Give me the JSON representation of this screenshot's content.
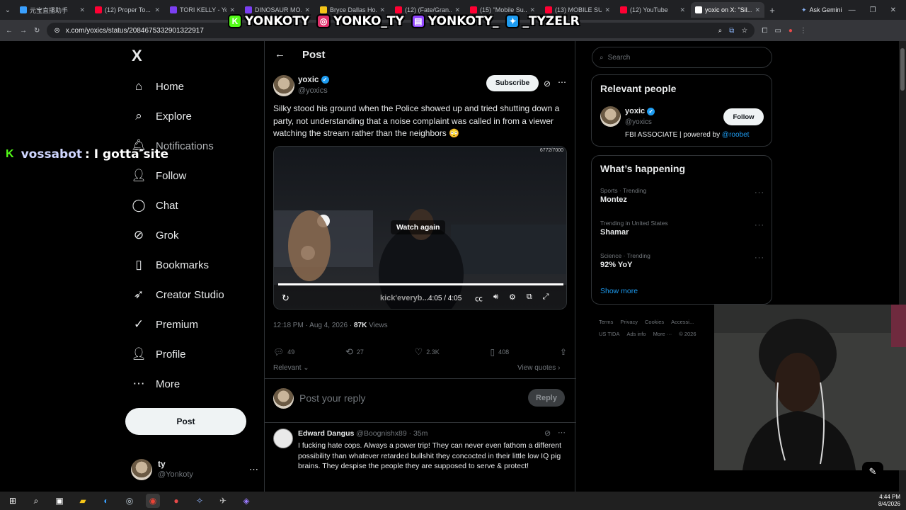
{
  "browser": {
    "tabs": [
      {
        "label": "元宝直播助手",
        "color": "#3aa0ff"
      },
      {
        "label": "(12) Proper To...",
        "color": "#ff0033"
      },
      {
        "label": "TORI KELLY - Yo...",
        "color": "#7b3ff2"
      },
      {
        "label": "DINOSAUR MO...",
        "color": "#7b3ff2"
      },
      {
        "label": "Bryce Dallas Ho...",
        "color": "#f5c518"
      },
      {
        "label": "(12) (Fate/Gran...",
        "color": "#ff0033"
      },
      {
        "label": "(15) \"Mobile Su...",
        "color": "#ff0033"
      },
      {
        "label": "(13) MOBILE SU...",
        "color": "#ff0033"
      },
      {
        "label": "(12) YouTube",
        "color": "#ff0033"
      },
      {
        "label": "yoxic on X: \"Sil...",
        "color": "#ffffff"
      }
    ],
    "new_tab": "+",
    "ask_gemini": "Ask Gemini",
    "url": "x.com/yoxics/status/2084675332901322917"
  },
  "stream_overlay": {
    "handles": [
      {
        "platform": "kick",
        "text": "YONKOTY"
      },
      {
        "platform": "instagram",
        "text": "YONKO_TY"
      },
      {
        "platform": "twitch",
        "text": "YONKOTY_"
      },
      {
        "platform": "twitter",
        "text": "_TYZELR"
      }
    ],
    "chat_user": "vossabot",
    "chat_message": ": I gotta site"
  },
  "nav": {
    "logo": "X",
    "items": [
      {
        "label": "Home",
        "icon": "⌂",
        "icon_name": "home-icon"
      },
      {
        "label": "Explore",
        "icon": "⌕",
        "icon_name": "search-icon"
      },
      {
        "label": "Notifications",
        "icon": "🔔︎",
        "icon_name": "bell-icon"
      },
      {
        "label": "Follow",
        "icon": "👤︎",
        "icon_name": "add-person-icon"
      },
      {
        "label": "Chat",
        "icon": "◯",
        "icon_name": "chat-icon"
      },
      {
        "label": "Grok",
        "icon": "⊘",
        "icon_name": "grok-icon"
      },
      {
        "label": "Bookmarks",
        "icon": "▯",
        "icon_name": "bookmark-icon"
      },
      {
        "label": "Creator Studio",
        "icon": "➶",
        "icon_name": "creator-studio-icon"
      },
      {
        "label": "Premium",
        "icon": "✓",
        "icon_name": "premium-icon"
      },
      {
        "label": "Profile",
        "icon": "👤︎",
        "icon_name": "profile-icon"
      },
      {
        "label": "More",
        "icon": "⋯",
        "icon_name": "more-icon"
      }
    ],
    "post_button": "Post",
    "account": {
      "name": "ty",
      "handle": "@Yonkoty"
    }
  },
  "post": {
    "header_title": "Post",
    "author_name": "yoxic",
    "author_handle": "@yoxics",
    "subscribe_label": "Subscribe",
    "text": "Silky stood his ground when the Police showed up and tried shutting down a party, not understanding that a noise complaint was called in from a viewer watching the stream rather than the neighbors 😳",
    "video": {
      "watch_again": "Watch again",
      "time": "4:05 / 4:05",
      "viewer_count": "6772/7000",
      "overlay_caption": "kick'everyb...",
      "progress": 1.0
    },
    "time": "12:18 PM",
    "date": "Aug 4, 2026",
    "views_count": "87K",
    "views_label": "Views",
    "stats": {
      "replies": "49",
      "reposts": "27",
      "likes": "2.3K",
      "bookmarks": "408"
    },
    "sort_label": "Relevant",
    "view_quotes": "View quotes",
    "reply_placeholder": "Post your reply",
    "reply_button": "Reply"
  },
  "reply": {
    "author_name": "Edward Dangus",
    "author_handle": "@Boognishx89",
    "time": "· 35m",
    "text": "I fucking hate cops. Always a power trip! They can never even fathom a different possibility than whatever retarded bullshit they concocted in their little low IQ pig brains. They despise the people they are supposed to serve & protect!"
  },
  "sidebar": {
    "search_placeholder": "Search",
    "relevant_title": "Relevant people",
    "person": {
      "name": "yoxic",
      "handle": "@yoxics",
      "bio": "FBI ASSOCIATE | powered by ",
      "bio_link": "@roobet",
      "follow_label": "Follow"
    },
    "happening_title": "What’s happening",
    "trends": [
      {
        "category": "Sports · Trending",
        "name": "Montez"
      },
      {
        "category": "Trending in United States",
        "name": "Shamar"
      },
      {
        "category": "Science · Trending",
        "name": "92% YoY"
      }
    ],
    "show_more": "Show more",
    "footer_line1": [
      "Terms",
      "Privacy",
      "Cookies",
      "Accessi..."
    ],
    "footer_line2": [
      "US TIDA",
      "Ads info",
      "More ···",
      "© 2026"
    ]
  },
  "taskbar": {
    "time": "4:44 PM",
    "date": "8/4/2026"
  }
}
